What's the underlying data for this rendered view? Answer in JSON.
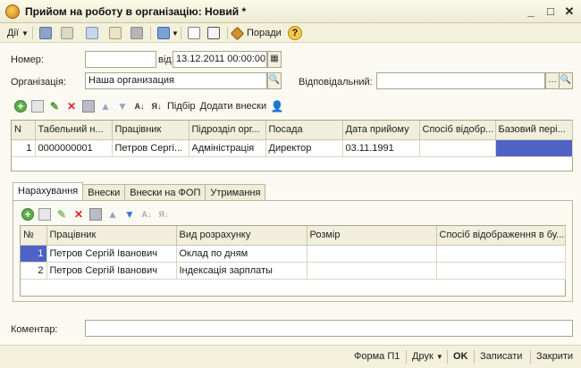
{
  "window": {
    "title": "Прийом на роботу в організацію: Новий *"
  },
  "toolbar": {
    "actions_label": "Дії",
    "help_label": "Поради"
  },
  "form": {
    "number_label": "Номер:",
    "number_value": "",
    "date_label": "від:",
    "date_value": "13.12.2011 00:00:00",
    "org_label": "Організація:",
    "org_value": "Наша организация",
    "responsible_label": "Відповідальний:",
    "responsible_value": ""
  },
  "employees_bar": {
    "pick_label": "Підбір",
    "add_contrib_label": "Додати внески"
  },
  "employees_table": {
    "headers": [
      "N",
      "Табельний н...",
      "Працівник",
      "Підрозділ орг...",
      "Посада",
      "Дата прийому",
      "Спосіб відобр...",
      "Базовий пері..."
    ],
    "rows": [
      [
        "1",
        "0000000001",
        "Петров Сергі...",
        "Адміністрація",
        "Директор",
        "03.11.1991",
        "",
        ""
      ]
    ]
  },
  "tabs": [
    "Нарахування",
    "Внески",
    "Внески на ФОП",
    "Утримання"
  ],
  "accruals_table": {
    "headers": [
      "№",
      "Працівник",
      "Вид розрахунку",
      "Розмір",
      "Спосіб відображення в бу..."
    ],
    "rows": [
      [
        "1",
        "Петров Сергій Іванович",
        "Оклад по дням",
        "",
        ""
      ],
      [
        "2",
        "Петров Сергій Іванович",
        "Індексація зарплаты",
        "",
        ""
      ]
    ]
  },
  "comment": {
    "label": "Коментар:",
    "value": ""
  },
  "footer": {
    "form_label": "Форма П1",
    "print_label": "Друк",
    "ok_label": "OK",
    "save_label": "Записати",
    "close_label": "Закрити"
  },
  "colors": {
    "accent_selection": "#4f62c6",
    "row_selection": "#d6dbf3"
  }
}
